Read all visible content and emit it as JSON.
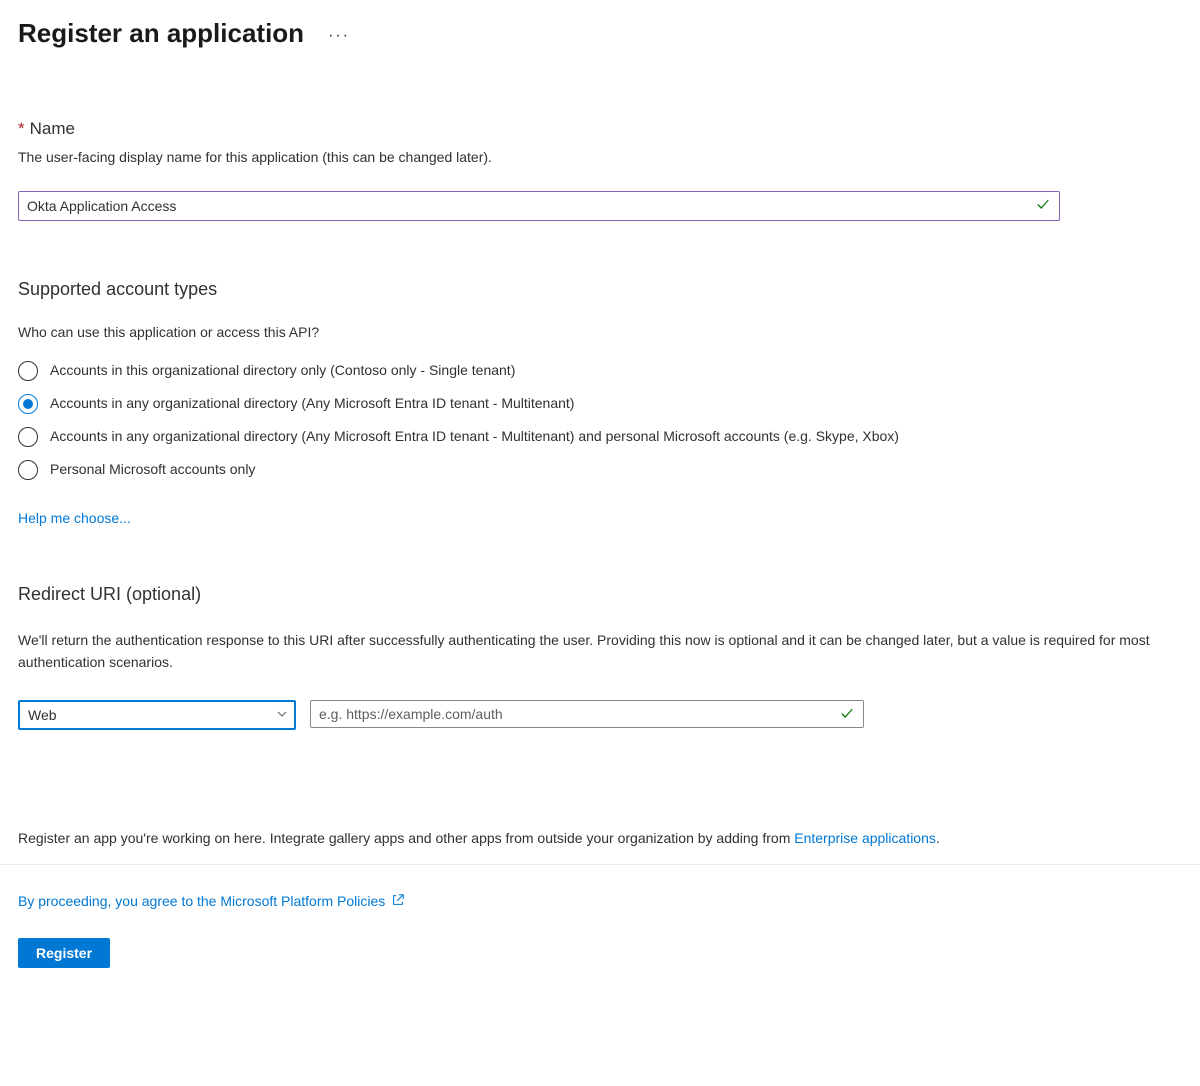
{
  "header": {
    "title": "Register an application"
  },
  "name_section": {
    "label": "Name",
    "help": "The user-facing display name for this application (this can be changed later).",
    "value": "Okta Application Access"
  },
  "account_types": {
    "title": "Supported account types",
    "subtitle": "Who can use this application or access this API?",
    "options": [
      {
        "label": "Accounts in this organizational directory only (Contoso only - Single tenant)",
        "selected": false
      },
      {
        "label": "Accounts in any organizational directory (Any Microsoft Entra ID tenant - Multitenant)",
        "selected": true
      },
      {
        "label": "Accounts in any organizational directory (Any Microsoft Entra ID tenant - Multitenant) and personal Microsoft accounts (e.g. Skype, Xbox)",
        "selected": false
      },
      {
        "label": "Personal Microsoft accounts only",
        "selected": false
      }
    ],
    "help_link": "Help me choose..."
  },
  "redirect": {
    "title": "Redirect URI (optional)",
    "help": "We'll return the authentication response to this URI after successfully authenticating the user. Providing this now is optional and it can be changed later, but a value is required for most authentication scenarios.",
    "platform_value": "Web",
    "uri_placeholder": "e.g. https://example.com/auth"
  },
  "footer": {
    "integrate_note_prefix": "Register an app you're working on here. Integrate gallery apps and other apps from outside your organization by adding from ",
    "integrate_link": "Enterprise applications",
    "policies_text": "By proceeding, you agree to the Microsoft Platform Policies",
    "register_button": "Register"
  }
}
